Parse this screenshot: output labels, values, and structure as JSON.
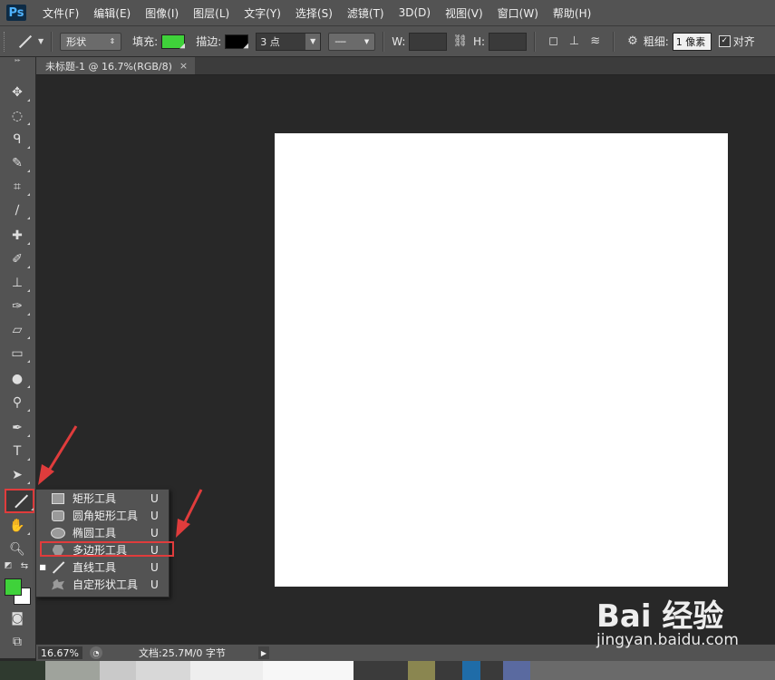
{
  "app": {
    "logo": "Ps"
  },
  "menu": [
    "文件(F)",
    "编辑(E)",
    "图像(I)",
    "图层(L)",
    "文字(Y)",
    "选择(S)",
    "滤镜(T)",
    "3D(D)",
    "视图(V)",
    "窗口(W)",
    "帮助(H)"
  ],
  "options": {
    "mode": "形状",
    "fill_label": "填充:",
    "fill_color": "#3fd23a",
    "stroke_label": "描边:",
    "stroke_color": "#000000",
    "stroke_width": "3 点",
    "w_label": "W:",
    "h_label": "H:",
    "weight_label": "粗细:",
    "weight_value": "1 像素",
    "align_label": "对齐"
  },
  "document_tab": {
    "title": "未标题-1 @ 16.7%(RGB/8)",
    "close": "×"
  },
  "toolbar": {
    "fg_color": "#3fd23a",
    "bg_color": "#ffffff"
  },
  "flyout": {
    "items": [
      {
        "name": "矩形工具",
        "key": "U",
        "icon": "rectangle-icon"
      },
      {
        "name": "圆角矩形工具",
        "key": "U",
        "icon": "rounded-rectangle-icon"
      },
      {
        "name": "椭圆工具",
        "key": "U",
        "icon": "ellipse-icon"
      },
      {
        "name": "多边形工具",
        "key": "U",
        "icon": "polygon-icon"
      },
      {
        "name": "直线工具",
        "key": "U",
        "icon": "line-icon"
      },
      {
        "name": "自定形状工具",
        "key": "U",
        "icon": "custom-shape-icon"
      }
    ]
  },
  "status": {
    "zoom": "16.67%",
    "doc_info": "文档:25.7M/0 字节"
  },
  "watermark": {
    "brand": "Bai 经验",
    "url": "jingyan.baidu.com"
  },
  "colors": {
    "annotation_red": "#e03c3c",
    "canvas": "#ffffff",
    "workspace": "#282828"
  }
}
